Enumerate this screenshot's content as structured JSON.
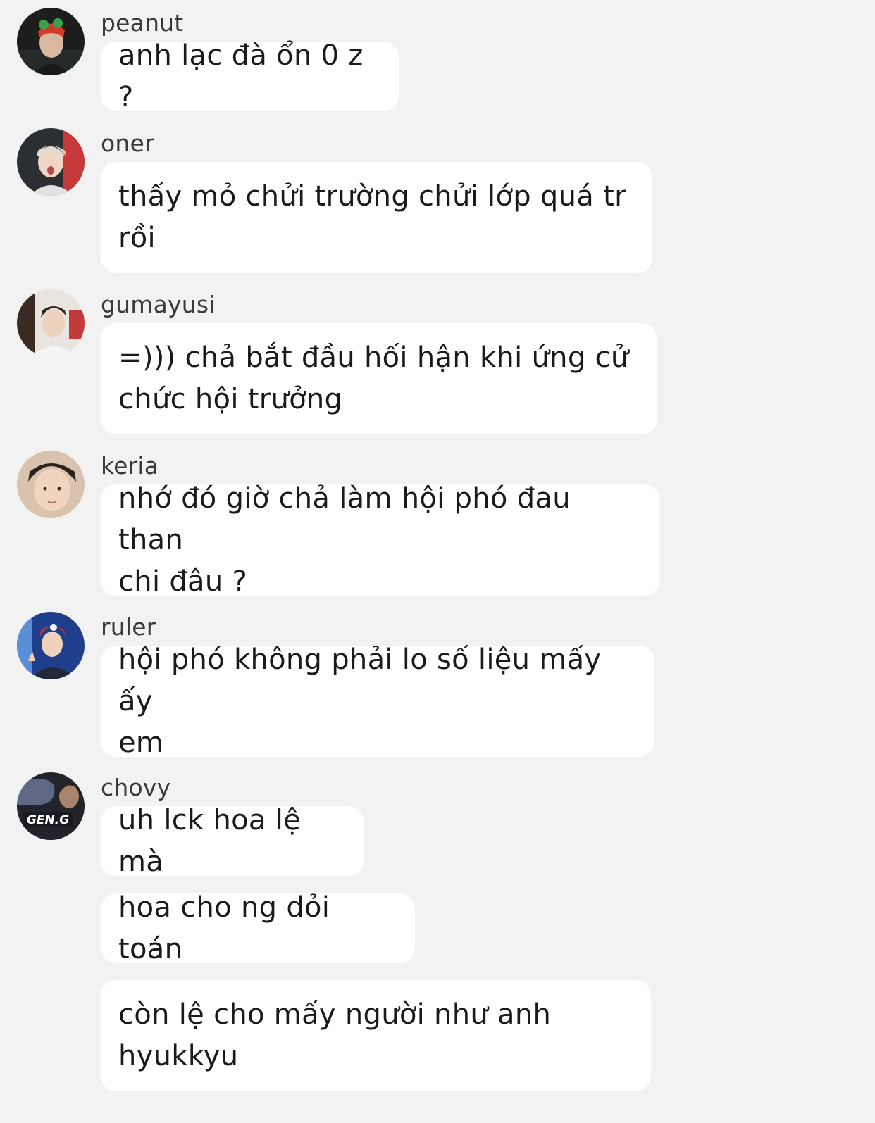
{
  "messages": [
    {
      "sender": "peanut",
      "avatar_icon": "peanut-avatar-icon",
      "bubbles": [
        "anh lạc đà ổn 0 z ?"
      ]
    },
    {
      "sender": "oner",
      "avatar_icon": "oner-avatar-icon",
      "bubbles": [
        "thấy mỏ chửi trường chửi lớp quá tr\nrồi"
      ]
    },
    {
      "sender": "gumayusi",
      "avatar_icon": "gumayusi-avatar-icon",
      "bubbles": [
        "=))) chả bắt đầu hối hận khi ứng cử\nchức hội trưởng"
      ]
    },
    {
      "sender": "keria",
      "avatar_icon": "keria-avatar-icon",
      "bubbles": [
        "nhớ đó giờ chả làm hội phó đau than\nchi đâu ?"
      ]
    },
    {
      "sender": "ruler",
      "avatar_icon": "ruler-avatar-icon",
      "bubbles": [
        "hội phó không phải lo số liệu mấy ấy\nem"
      ]
    },
    {
      "sender": "chovy",
      "avatar_icon": "chovy-avatar-icon",
      "avatar_text": "GEN.G",
      "bubbles": [
        "uh lck hoa lệ mà",
        "hoa cho ng dỏi toán",
        "còn lệ cho mấy người như anh\nhyukkyu"
      ]
    }
  ]
}
